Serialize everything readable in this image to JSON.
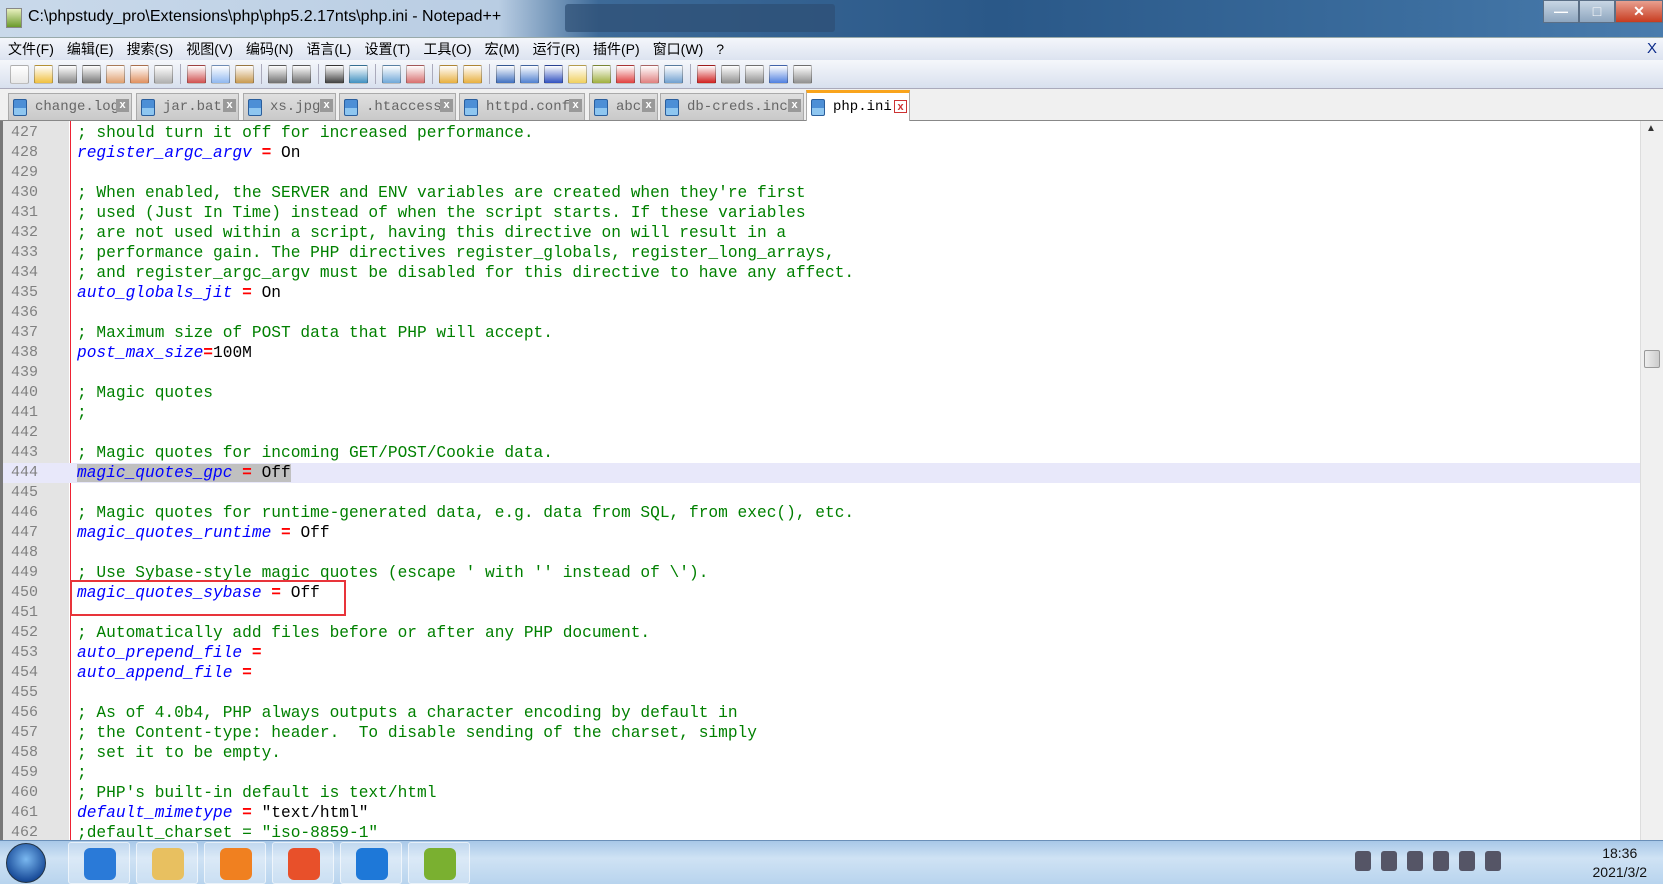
{
  "window": {
    "title": "C:\\phpstudy_pro\\Extensions\\php\\php5.2.17nts\\php.ini - Notepad++",
    "minimize": "—",
    "maximize": "□",
    "close": "✕"
  },
  "menu": {
    "items": [
      "文件(F)",
      "编辑(E)",
      "搜索(S)",
      "视图(V)",
      "编码(N)",
      "语言(L)",
      "设置(T)",
      "工具(O)",
      "宏(M)",
      "运行(R)",
      "插件(P)",
      "窗口(W)",
      "?"
    ],
    "close": "X"
  },
  "toolbar": {
    "icons": [
      {
        "name": "new-file-icon",
        "color": "#e8e8e8"
      },
      {
        "name": "open-file-icon",
        "color": "#f0c040"
      },
      {
        "name": "save-icon",
        "color": "#888888"
      },
      {
        "name": "save-all-icon",
        "color": "#777777"
      },
      {
        "name": "close-icon",
        "color": "#e0a070"
      },
      {
        "name": "close-all-icon",
        "color": "#e09060"
      },
      {
        "name": "print-icon",
        "color": "#b0b0b0"
      },
      {
        "sep": true
      },
      {
        "name": "cut-icon",
        "color": "#d05050"
      },
      {
        "name": "copy-icon",
        "color": "#90b8f0"
      },
      {
        "name": "paste-icon",
        "color": "#c89a50"
      },
      {
        "sep": true
      },
      {
        "name": "undo-icon",
        "color": "#707070"
      },
      {
        "name": "redo-icon",
        "color": "#707070"
      },
      {
        "sep": true
      },
      {
        "name": "find-icon",
        "color": "#404040"
      },
      {
        "name": "replace-icon",
        "color": "#4090c0"
      },
      {
        "sep": true
      },
      {
        "name": "zoom-in-icon",
        "color": "#70a8d8"
      },
      {
        "name": "zoom-out-icon",
        "color": "#d87070"
      },
      {
        "sep": true
      },
      {
        "name": "sync-vertical-icon",
        "color": "#e8b040"
      },
      {
        "name": "sync-horizontal-icon",
        "color": "#e8b040"
      },
      {
        "sep": true
      },
      {
        "name": "word-wrap-icon",
        "color": "#4070c0"
      },
      {
        "name": "show-all-chars-icon",
        "color": "#5080d0"
      },
      {
        "name": "indent-guide-icon",
        "color": "#3050c0"
      },
      {
        "name": "udl-icon",
        "color": "#f0d060"
      },
      {
        "name": "doc-map-icon",
        "color": "#a0b040"
      },
      {
        "name": "function-list-icon",
        "color": "#e04040"
      },
      {
        "name": "folder-workspace-icon",
        "color": "#e08080"
      },
      {
        "name": "monitoring-icon",
        "color": "#70a0d0"
      },
      {
        "sep": true
      },
      {
        "name": "record-macro-icon",
        "color": "#d02020"
      },
      {
        "name": "stop-record-icon",
        "color": "#909090"
      },
      {
        "name": "play-macro-icon",
        "color": "#909090"
      },
      {
        "name": "run-macro-multiple-icon",
        "color": "#5080e0"
      },
      {
        "name": "save-macro-icon",
        "color": "#909090"
      }
    ]
  },
  "tabs": [
    {
      "label": "change.log",
      "active": false
    },
    {
      "label": "jar.bat",
      "active": false
    },
    {
      "label": "xs.jpg",
      "active": false
    },
    {
      "label": ".htaccess",
      "active": false
    },
    {
      "label": "httpd.conf",
      "active": false
    },
    {
      "label": "abc",
      "active": false
    },
    {
      "label": "db-creds.inc",
      "active": false
    },
    {
      "label": "php.ini",
      "active": true
    }
  ],
  "tab_close": "x",
  "editor": {
    "current_line": 444,
    "lines": [
      {
        "n": "427",
        "comment": "; should turn it off for increased performance."
      },
      {
        "n": "428",
        "key": "register_argc_argv",
        "sp": " ",
        "eq": "=",
        "val": "On"
      },
      {
        "n": "429"
      },
      {
        "n": "430",
        "comment": "; When enabled, the SERVER and ENV variables are created when they're first"
      },
      {
        "n": "431",
        "comment": "; used (Just In Time) instead of when the script starts. If these variables"
      },
      {
        "n": "432",
        "comment": "; are not used within a script, having this directive on will result in a"
      },
      {
        "n": "433",
        "comment": "; performance gain. The PHP directives register_globals, register_long_arrays,"
      },
      {
        "n": "434",
        "comment": "; and register_argc_argv must be disabled for this directive to have any affect."
      },
      {
        "n": "435",
        "key": "auto_globals_jit",
        "sp": " ",
        "eq": "=",
        "val": "On"
      },
      {
        "n": "436"
      },
      {
        "n": "437",
        "comment": "; Maximum size of POST data that PHP will accept."
      },
      {
        "n": "438",
        "key": "post_max_size",
        "sp": "",
        "eq": "=",
        "val": "100M"
      },
      {
        "n": "439"
      },
      {
        "n": "440",
        "comment": "; Magic quotes"
      },
      {
        "n": "441",
        "comment": ";"
      },
      {
        "n": "442"
      },
      {
        "n": "443",
        "comment": "; Magic quotes for incoming GET/POST/Cookie data."
      },
      {
        "n": "444",
        "key": "magic_quotes_gpc",
        "sp": " ",
        "eq": "=",
        "val": "Off",
        "selected": true
      },
      {
        "n": "445"
      },
      {
        "n": "446",
        "comment": "; Magic quotes for runtime-generated data, e.g. data from SQL, from exec(), etc."
      },
      {
        "n": "447",
        "key": "magic_quotes_runtime",
        "sp": " ",
        "eq": "=",
        "val": "Off"
      },
      {
        "n": "448"
      },
      {
        "n": "449",
        "comment": "; Use Sybase-style magic quotes (escape ' with '' instead of \\')."
      },
      {
        "n": "450",
        "key": "magic_quotes_sybase",
        "sp": " ",
        "eq": "=",
        "val": "Off"
      },
      {
        "n": "451"
      },
      {
        "n": "452",
        "comment": "; Automatically add files before or after any PHP document."
      },
      {
        "n": "453",
        "key": "auto_prepend_file",
        "sp": " ",
        "eq": "=",
        "val": ""
      },
      {
        "n": "454",
        "key": "auto_append_file",
        "sp": " ",
        "eq": "=",
        "val": ""
      },
      {
        "n": "455"
      },
      {
        "n": "456",
        "comment": "; As of 4.0b4, PHP always outputs a character encoding by default in"
      },
      {
        "n": "457",
        "comment": "; the Content-type: header.  To disable sending of the charset, simply"
      },
      {
        "n": "458",
        "comment": "; set it to be empty."
      },
      {
        "n": "459",
        "comment": ";"
      },
      {
        "n": "460",
        "comment": "; PHP's built-in default is text/html"
      },
      {
        "n": "461",
        "key": "default_mimetype",
        "sp": " ",
        "eq": "=",
        "val": "\"text/html\""
      },
      {
        "n": "462",
        "comment": ";default_charset = \"iso-8859-1\""
      }
    ]
  },
  "taskbar": {
    "apps": [
      {
        "name": "internet-explorer-icon",
        "color": "#2a7ad8"
      },
      {
        "name": "file-explorer-icon",
        "color": "#e8c060"
      },
      {
        "name": "media-player-icon",
        "color": "#f08020"
      },
      {
        "name": "firefox-icon",
        "color": "#e8502a"
      },
      {
        "name": "phpstudy-icon",
        "color": "#1e78d8"
      },
      {
        "name": "notepad-plus-plus-icon",
        "color": "#7ab030"
      }
    ],
    "tray_icons": [
      "keyboard-icon",
      "help-icon",
      "show-hidden-icon",
      "flag-icon",
      "network-icon",
      "volume-icon"
    ],
    "time": "18:36",
    "date": "2021/3/2"
  }
}
